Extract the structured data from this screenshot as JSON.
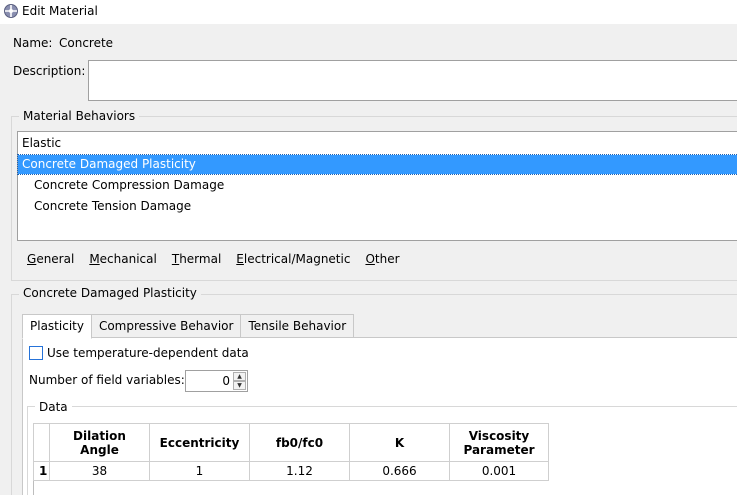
{
  "window": {
    "title": "Edit Material",
    "icon": "abaqus-material-icon"
  },
  "name": {
    "label": "Name:",
    "value": "Concrete"
  },
  "description": {
    "label": "Description:",
    "value": ""
  },
  "material_behaviors": {
    "title": "Material Behaviors",
    "items": [
      {
        "label": "Elastic",
        "selected": false,
        "indent": 0
      },
      {
        "label": "Concrete Damaged Plasticity",
        "selected": true,
        "indent": 0
      },
      {
        "label": "Concrete Compression Damage",
        "selected": false,
        "indent": 1
      },
      {
        "label": "Concrete Tension Damage",
        "selected": false,
        "indent": 1
      }
    ]
  },
  "menu": [
    {
      "mnemonic": "G",
      "rest": "eneral"
    },
    {
      "mnemonic": "M",
      "rest": "echanical"
    },
    {
      "mnemonic": "T",
      "rest": "hermal"
    },
    {
      "mnemonic": "E",
      "rest": "lectrical/Magnetic"
    },
    {
      "mnemonic": "O",
      "rest": "ther"
    }
  ],
  "section": {
    "title": "Concrete Damaged Plasticity",
    "tabs": [
      "Plasticity",
      "Compressive Behavior",
      "Tensile Behavior"
    ],
    "active_tab": "Plasticity",
    "temp_dependent": {
      "label": "Use temperature-dependent data",
      "checked": false
    },
    "field_vars": {
      "label": "Number of field variables:",
      "value": "0"
    },
    "data_title": "Data",
    "table": {
      "headers": [
        "Dilation Angle",
        "Eccentricity",
        "fb0/fc0",
        "K",
        "Viscosity Parameter"
      ],
      "rows": [
        {
          "index": "1",
          "cells": [
            "38",
            "1",
            "1.12",
            "0.666",
            "0.001"
          ]
        }
      ]
    }
  },
  "colors": {
    "selection": "#3399ff",
    "background": "#f0f0f0",
    "checkbox_border": "#2673d9"
  }
}
